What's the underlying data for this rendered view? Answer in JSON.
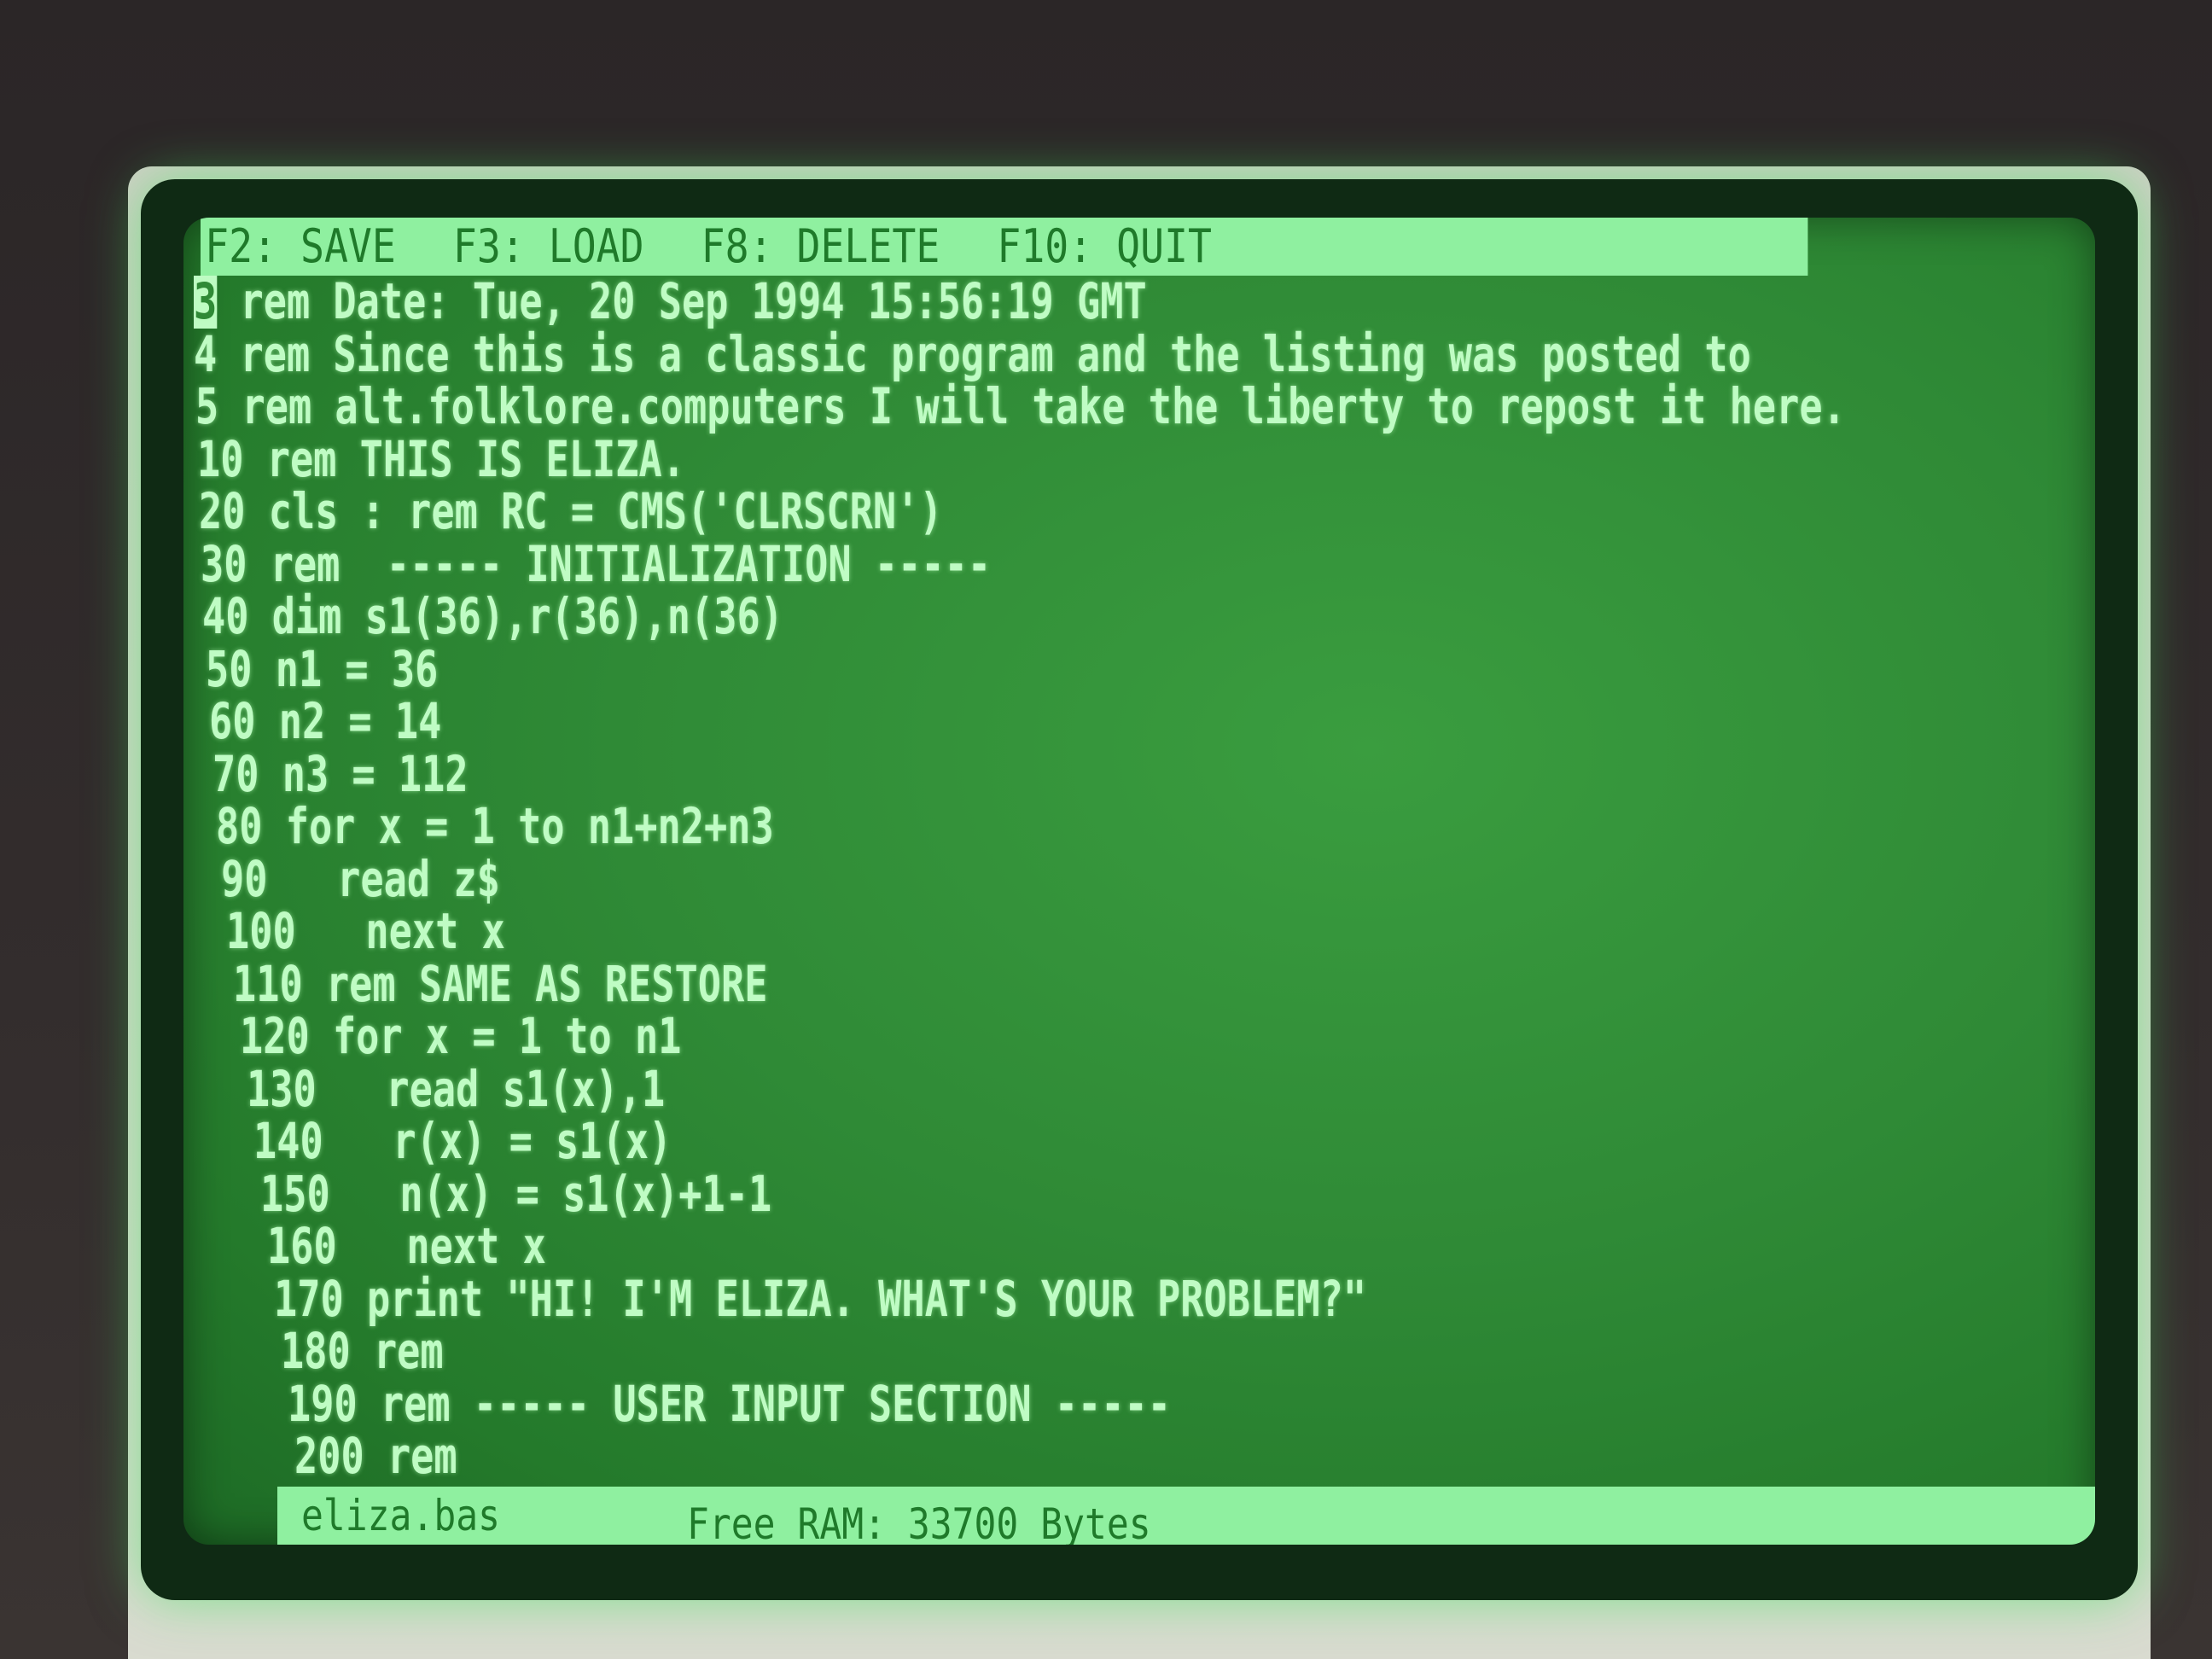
{
  "menu_bar": {
    "items": [
      {
        "label": "F2: SAVE"
      },
      {
        "label": "F3: LOAD"
      },
      {
        "label": "F8: DELETE"
      },
      {
        "label": "F10: QUIT"
      }
    ]
  },
  "editor": {
    "cursor_char": "3",
    "lines": [
      " rem Date: Tue, 20 Sep 1994 15:56:19 GMT",
      "4 rem Since this is a classic program and the listing was posted to",
      "5 rem alt.folklore.computers I will take the liberty to repost it here.",
      "10 rem THIS IS ELIZA.",
      "20 cls : rem RC = CMS('CLRSCRN')",
      "30 rem  ----- INITIALIZATION -----",
      "40 dim s1(36),r(36),n(36)",
      "50 n1 = 36",
      "60 n2 = 14",
      "70 n3 = 112",
      "80 for x = 1 to n1+n2+n3",
      "90   read z$",
      "100   next x",
      "110 rem SAME AS RESTORE",
      "120 for x = 1 to n1",
      "130   read s1(x),1",
      "140   r(x) = s1(x)",
      "150   n(x) = s1(x)+1-1",
      "160   next x",
      "170 print \"HI! I'M ELIZA. WHAT'S YOUR PROBLEM?\"",
      "180 rem",
      "190 rem ----- USER INPUT SECTION -----",
      "200 rem"
    ]
  },
  "status_bar": {
    "filename": "eliza.bas",
    "free_ram": "Free RAM: 33700 Bytes"
  }
}
